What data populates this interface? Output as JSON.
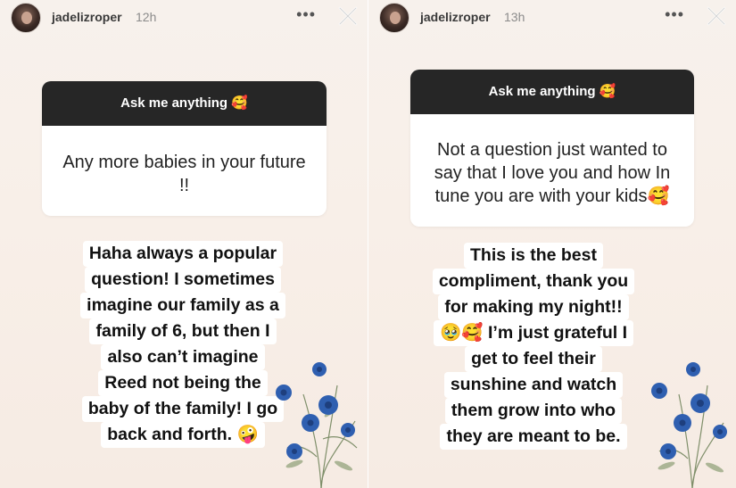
{
  "stories": [
    {
      "username": "jadelizroper",
      "time": "12h",
      "more_icon": "more-horizontal-icon",
      "close_icon": "close-icon",
      "question_header": "Ask me anything 🥰",
      "question": "Any more babies in your future !!",
      "reply_lines": [
        "Haha always a popular",
        "question! I sometimes",
        "imagine our family as a",
        "family of 6, but then I",
        "also can’t imagine",
        "Reed not being the",
        "baby of the family! I go",
        "back and forth. 🤪"
      ]
    },
    {
      "username": "jadelizroper",
      "time": "13h",
      "more_icon": "more-horizontal-icon",
      "close_icon": "close-icon",
      "question_header": "Ask me anything 🥰",
      "question": "Not a question just wanted to say that I love you and how In tune you are with your kids🥰",
      "reply_lines": [
        "This is the best",
        "compliment, thank you",
        "for making my night!!",
        "🥹🥰 I’m just grateful I",
        "get to feel their",
        "sunshine and watch",
        "them grow into who",
        "they are meant to be."
      ]
    }
  ],
  "colors": {
    "card_header": "#262626",
    "background": "#f7f0ea",
    "flower_blue": "#2f5fb0"
  }
}
